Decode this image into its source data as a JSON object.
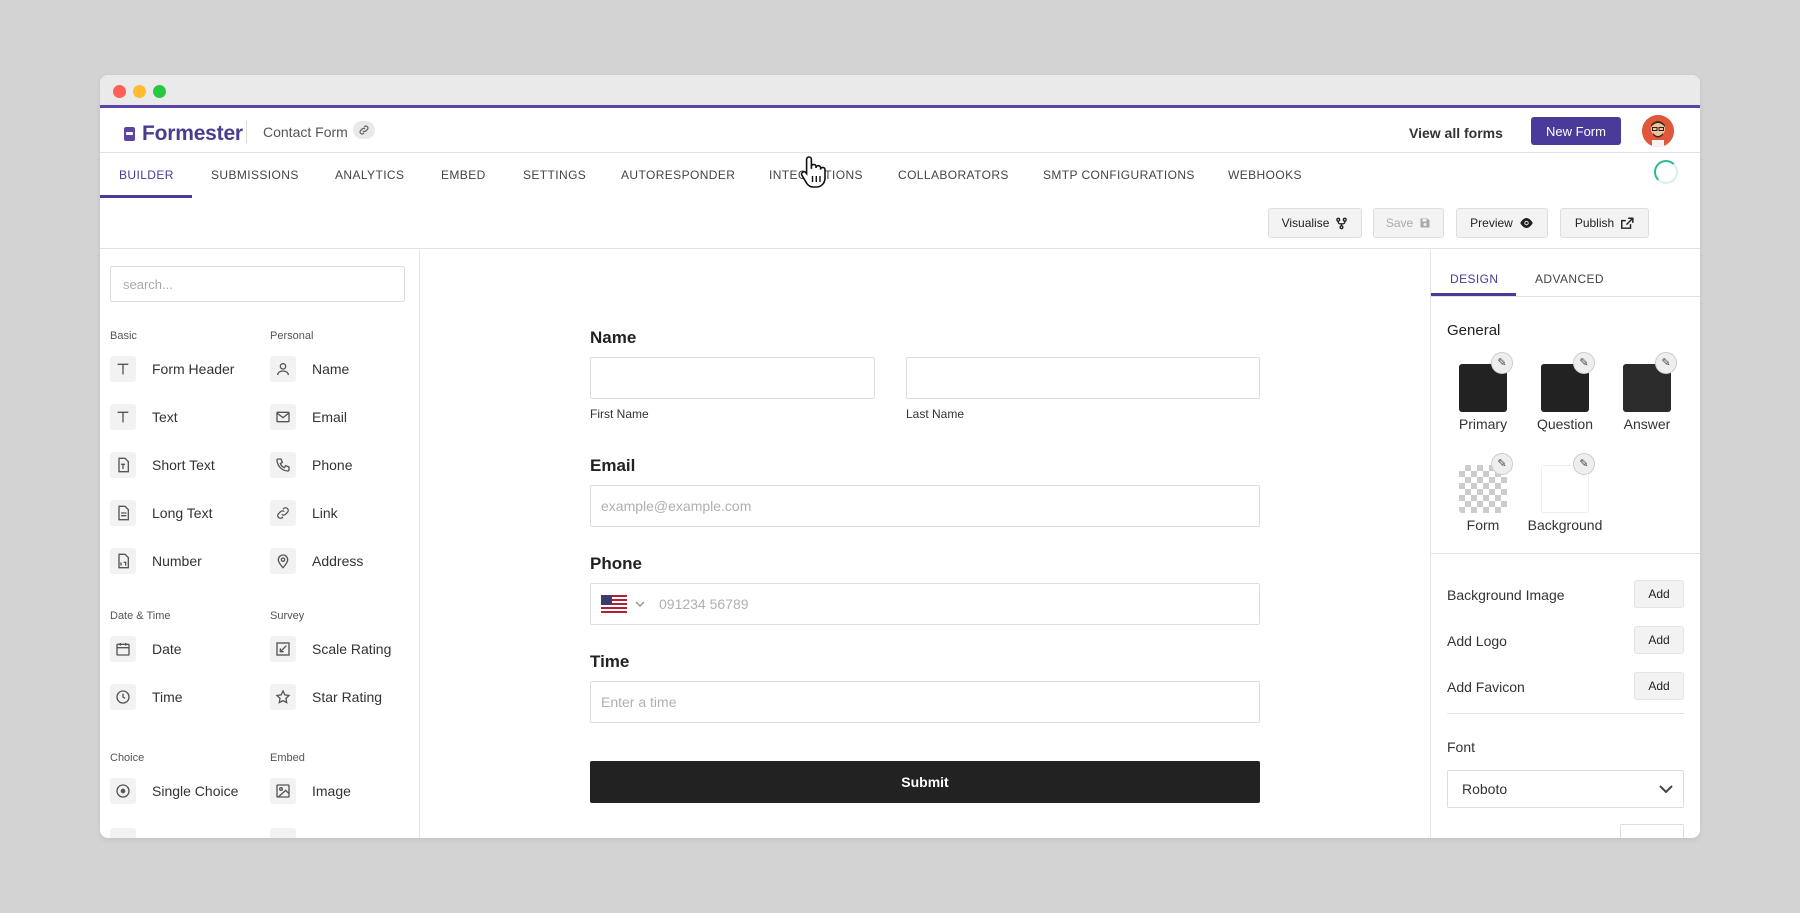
{
  "app": {
    "brand": "Formester",
    "form_name": "Contact Form"
  },
  "header": {
    "view_all": "View all forms",
    "new_form": "New Form"
  },
  "tabs": [
    "BUILDER",
    "SUBMISSIONS",
    "ANALYTICS",
    "EMBED",
    "SETTINGS",
    "AUTORESPONDER",
    "INTEGRATIONS",
    "COLLABORATORS",
    "SMTP CONFIGURATIONS",
    "WEBHOOKS"
  ],
  "actions": {
    "visualise": "Visualise",
    "save": "Save",
    "preview": "Preview",
    "publish": "Publish"
  },
  "sidebar": {
    "search_placeholder": "search...",
    "categories": {
      "basic": "Basic",
      "personal": "Personal",
      "datetime": "Date & Time",
      "survey": "Survey",
      "choice": "Choice",
      "embed": "Embed"
    },
    "basic_items": [
      "Form Header",
      "Text",
      "Short Text",
      "Long Text",
      "Number"
    ],
    "personal_items": [
      "Name",
      "Email",
      "Phone",
      "Link",
      "Address"
    ],
    "datetime_items": [
      "Date",
      "Time"
    ],
    "survey_items": [
      "Scale Rating",
      "Star Rating"
    ],
    "choice_items": [
      "Single Choice"
    ],
    "embed_items": [
      "Image"
    ]
  },
  "form": {
    "name_label": "Name",
    "first_name": "First Name",
    "last_name": "Last Name",
    "email_label": "Email",
    "email_placeholder": "example@example.com",
    "phone_label": "Phone",
    "phone_placeholder": "091234 56789",
    "time_label": "Time",
    "time_placeholder": "Enter a time",
    "submit": "Submit"
  },
  "design": {
    "tabs": [
      "DESIGN",
      "ADVANCED"
    ],
    "general": "General",
    "swatches": [
      {
        "label": "Primary",
        "color": "#222222"
      },
      {
        "label": "Question",
        "color": "#222222"
      },
      {
        "label": "Answer",
        "color": "#2c2c2c"
      },
      {
        "label": "Form",
        "color": "transparent"
      },
      {
        "label": "Background",
        "color": "#ffffff"
      }
    ],
    "background_image": "Background Image",
    "add_logo": "Add Logo",
    "add_favicon": "Add Favicon",
    "add": "Add",
    "font_label": "Font",
    "font_value": "Roboto"
  },
  "colors": {
    "accent": "#4a3a9a",
    "submit_bg": "#222222"
  }
}
